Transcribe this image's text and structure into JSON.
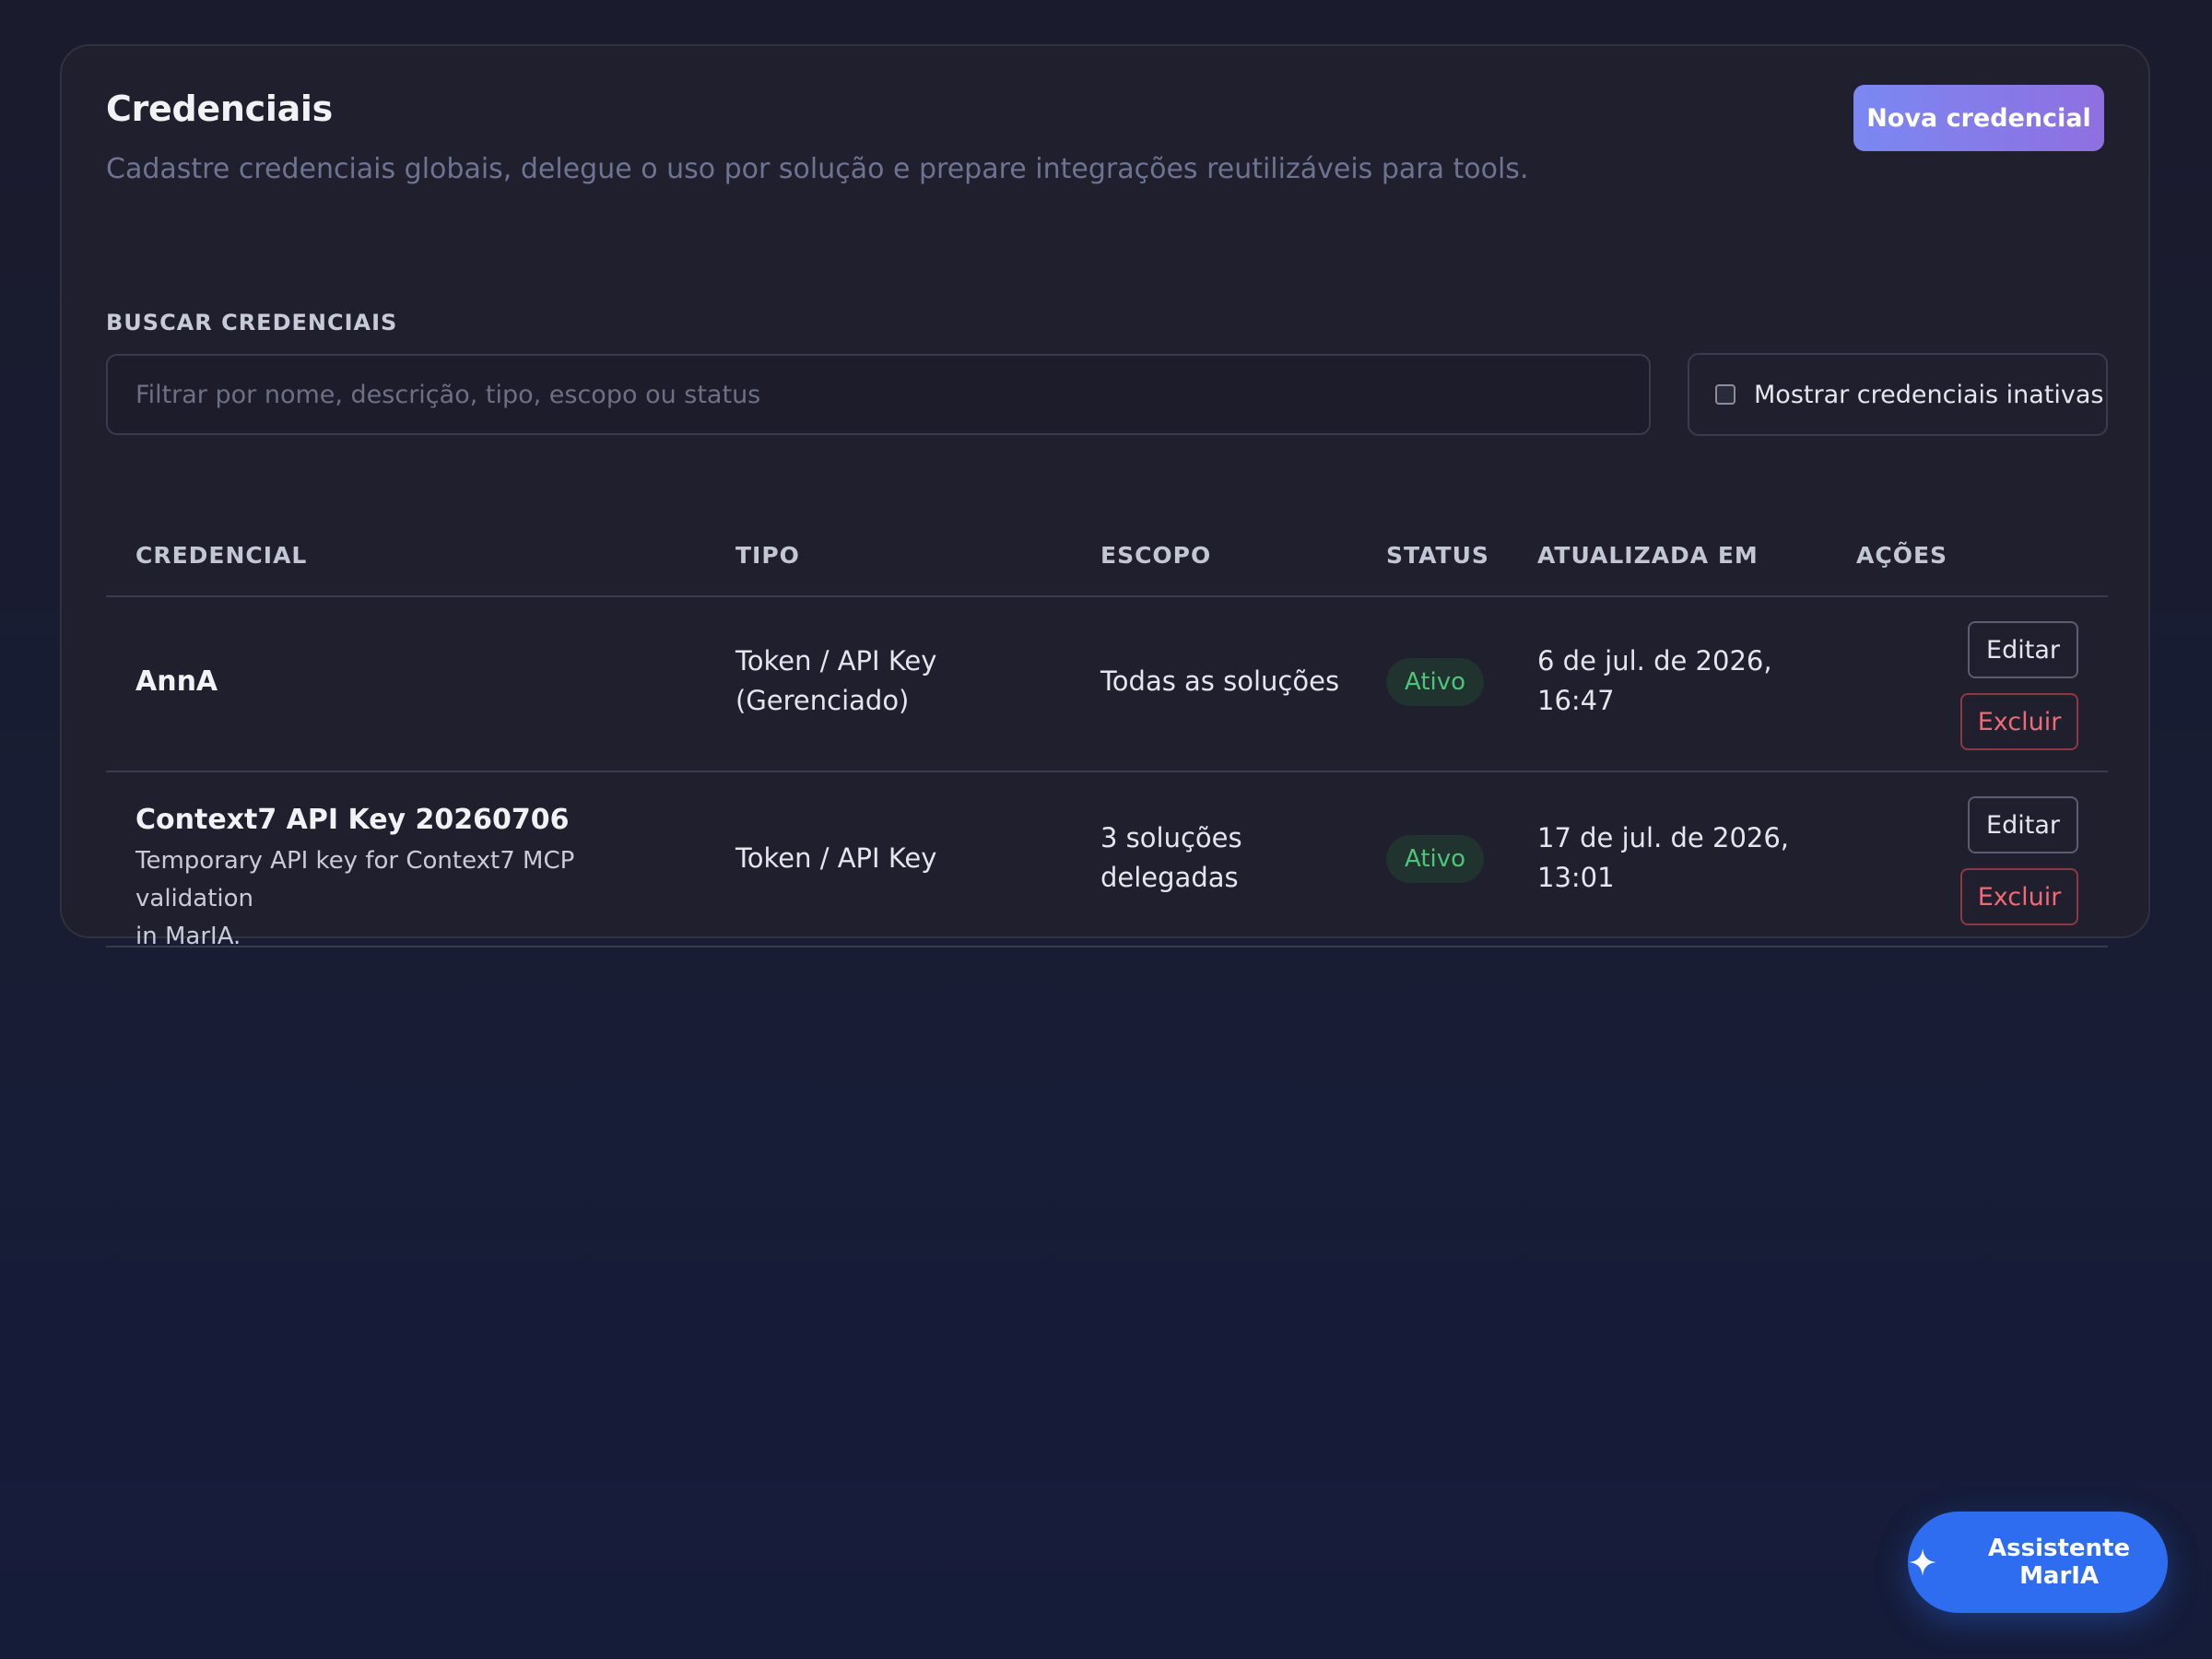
{
  "header": {
    "title": "Credenciais",
    "subtitle": "Cadastre credenciais globais, delegue o uso por solução e prepare integrações reutilizáveis para tools.",
    "new_button_label": "Nova credencial"
  },
  "search": {
    "label": "BUSCAR CREDENCIAIS",
    "placeholder": "Filtrar por nome, descrição, tipo, escopo ou status",
    "value": ""
  },
  "filters": {
    "show_inactive_label": "Mostrar credenciais inativas",
    "show_inactive_checked": false
  },
  "table": {
    "columns": [
      "CREDENCIAL",
      "TIPO",
      "ESCOPO",
      "STATUS",
      "ATUALIZADA EM",
      "AÇÕES"
    ],
    "rows": [
      {
        "name": "AnnA",
        "description": "",
        "type_line1": "Token / API Key",
        "type_line2": "(Gerenciado)",
        "scope_line1": "Todas as soluções",
        "scope_line2": "",
        "status": "Ativo",
        "updated_line1": "6 de jul. de 2026,",
        "updated_line2": "16:47",
        "edit_label": "Editar",
        "delete_label": "Excluir"
      },
      {
        "name": "Context7 API Key 20260706",
        "description_line1": "Temporary API key for Context7 MCP validation",
        "description_line2": "in MarIA.",
        "type_line1": "Token / API Key",
        "type_line2": "",
        "scope_line1": "3 soluções",
        "scope_line2": "delegadas",
        "status": "Ativo",
        "updated_line1": "17 de jul. de 2026,",
        "updated_line2": "13:01",
        "edit_label": "Editar",
        "delete_label": "Excluir"
      }
    ]
  },
  "assistant": {
    "label": "Assistente MarIA",
    "icon": "sparkle-icon"
  },
  "colors": {
    "accent_start": "#7b88f2",
    "accent_end": "#8f6fe0",
    "status_active_text": "#4cc579",
    "status_active_bg": "#20332f",
    "danger": "#ee6b76",
    "assistant_bg": "#2f6df0"
  }
}
